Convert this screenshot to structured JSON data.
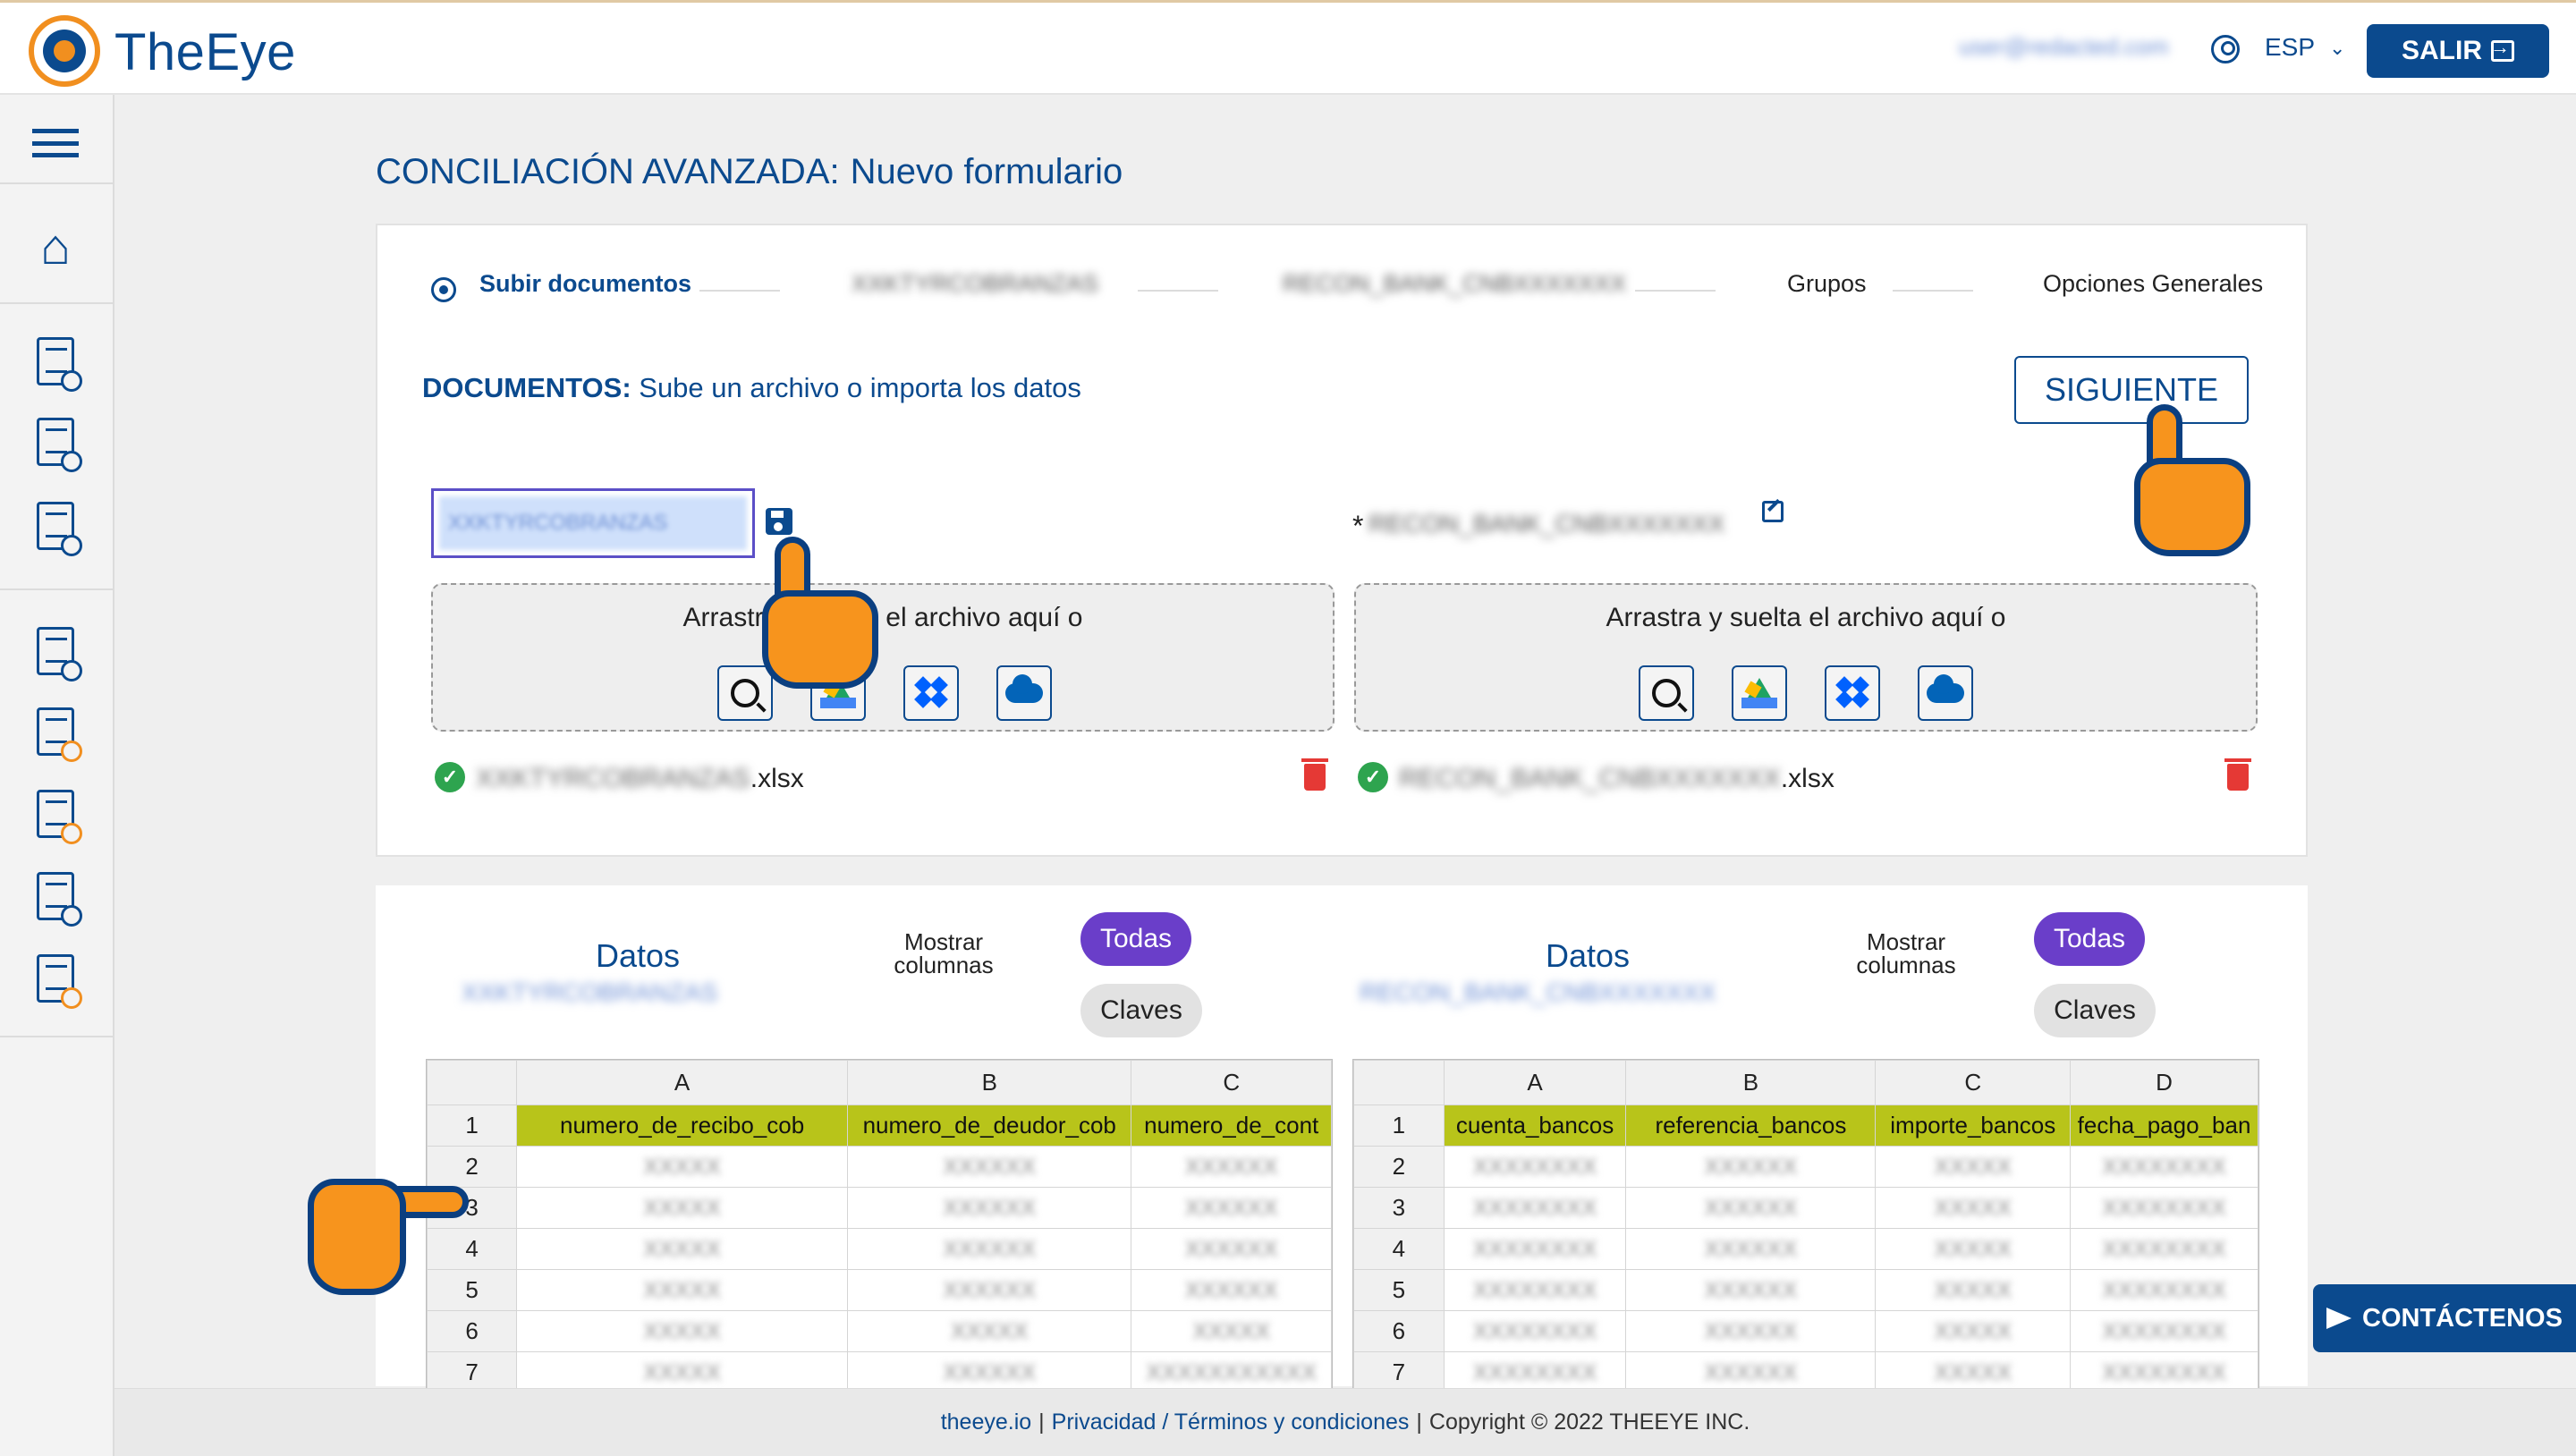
{
  "header": {
    "brand": "TheEye",
    "user_email": "user@redacted.com",
    "language": "ESP",
    "logout_label": "SALIR"
  },
  "page": {
    "title": "CONCILIACIÓN AVANZADA:",
    "subtitle": "Nuevo formulario"
  },
  "stepper": {
    "steps": [
      {
        "label": "Subir documentos"
      },
      {
        "label": "XXKTYRCOBRANZAS"
      },
      {
        "label": "RECON_BANK_CNBXXXXXXX"
      },
      {
        "label": "Grupos"
      },
      {
        "label": "Opciones Generales"
      }
    ]
  },
  "documents": {
    "label_bold": "DOCUMENTOS:",
    "label_rest": " Sube un archivo o importa los datos",
    "next_label": "SIGUIENTE",
    "left": {
      "name_value": "XXKTYRCOBRANZAS",
      "drop_text": "Arrastra y suelta el archivo aquí o",
      "file_blur": "XXKTYRCOBRANZAS",
      "file_ext": ".xlsx"
    },
    "right": {
      "required_mark": "*",
      "name_value": "RECON_BANK_CNBXXXXXXX",
      "drop_text": "Arrastra y suelta el archivo aquí o",
      "file_blur": "RECON_BANK_CNBXXXXXXX",
      "file_ext": ".xlsx"
    }
  },
  "data_panels": [
    {
      "title": "Datos",
      "subtitle": "XXKTYRCOBRANZAS",
      "show_columns": "Mostrar columnas",
      "all_label": "Todas",
      "keys_label": "Claves",
      "columns": [
        "A",
        "B",
        "C"
      ],
      "headers": [
        "numero_de_recibo_cob",
        "numero_de_deudor_cob",
        "numero_de_cont"
      ],
      "rows": [
        [
          "2",
          "XXXXX",
          "XXXXXX",
          "XXXXXX"
        ],
        [
          "3",
          "XXXXX",
          "XXXXXX",
          "XXXXXX"
        ],
        [
          "4",
          "XXXXX",
          "XXXXXX",
          "XXXXXX"
        ],
        [
          "5",
          "XXXXX",
          "XXXXXX",
          "XXXXXX"
        ],
        [
          "6",
          "XXXXX",
          "XXXXX",
          "XXXXX"
        ],
        [
          "7",
          "XXXXX",
          "XXXXXX",
          "XXXXXXXXXXX"
        ]
      ]
    },
    {
      "title": "Datos",
      "subtitle": "RECON_BANK_CNBXXXXXXX",
      "show_columns": "Mostrar columnas",
      "all_label": "Todas",
      "keys_label": "Claves",
      "columns": [
        "A",
        "B",
        "C",
        "D"
      ],
      "headers": [
        "cuenta_bancos",
        "referencia_bancos",
        "importe_bancos",
        "fecha_pago_ban"
      ],
      "rows": [
        [
          "2",
          "XXXXXXXX",
          "XXXXXX",
          "XXXXX",
          "XXXXXXXX"
        ],
        [
          "3",
          "XXXXXXXX",
          "XXXXXX",
          "XXXXX",
          "XXXXXXXX"
        ],
        [
          "4",
          "XXXXXXXX",
          "XXXXXX",
          "XXXXX",
          "XXXXXXXX"
        ],
        [
          "5",
          "XXXXXXXX",
          "XXXXXX",
          "XXXXX",
          "XXXXXXXX"
        ],
        [
          "6",
          "XXXXXXXX",
          "XXXXXX",
          "XXXXX",
          "XXXXXXXX"
        ],
        [
          "7",
          "XXXXXXXX",
          "XXXXXX",
          "XXXXX",
          "XXXXXXXX"
        ]
      ]
    }
  ],
  "footer": {
    "site": "theeye.io",
    "sep1": "|",
    "privacy": "Privacidad / Términos y condiciones",
    "sep2": "|",
    "copyright": "Copyright © 2022 THEEYE INC."
  },
  "contact_label": "CONTÁCTENOS",
  "colors": {
    "brand_blue": "#0b4a8e",
    "brand_orange": "#f18f1f",
    "pill_purple": "#6a3ec9",
    "header_green": "#b8c41a",
    "danger": "#e53935",
    "success": "#2ea44f"
  }
}
